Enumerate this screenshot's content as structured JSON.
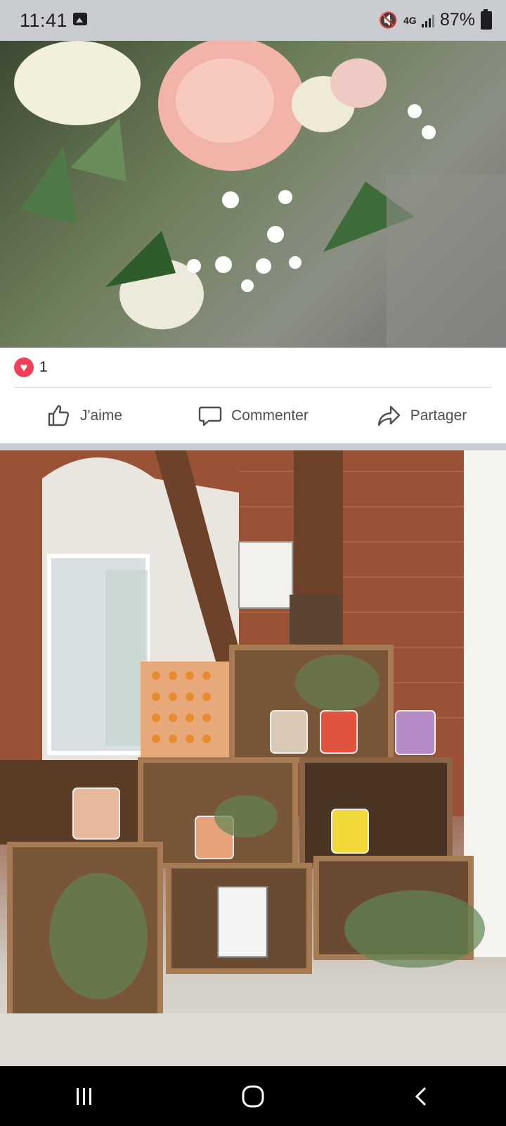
{
  "status_bar": {
    "time": "11:41",
    "battery": "87%",
    "network": "4G"
  },
  "post": {
    "reaction_icon": "love-icon",
    "reaction_count": "1",
    "actions": {
      "like": "J'aime",
      "comment": "Commenter",
      "share": "Partager"
    }
  },
  "colors": {
    "love": "#f33e58",
    "action_text": "#4b4f56",
    "status_bg": "#c9ccd1",
    "nav_bg": "#000000"
  }
}
